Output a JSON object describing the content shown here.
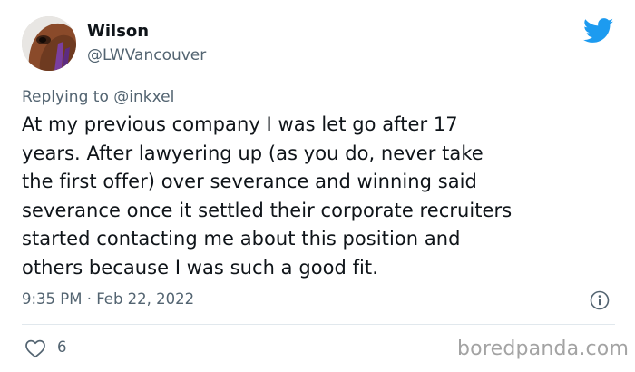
{
  "author": {
    "name": "Wilson",
    "handle": "@LWVancouver",
    "avatar_icon": "horse-avatar"
  },
  "reply_context": {
    "prefix": "Replying to",
    "mention": "@inkxel"
  },
  "tweet": {
    "lines": [
      "At my previous company I was let go after 17",
      "years. After lawyering up (as you do, never take",
      "the first offer) over severance and winning said",
      "severance once it settled their corporate recruiters",
      "started contacting me about this position and",
      "others because I was such a good fit."
    ],
    "timestamp": "9:35 PM · Feb 22, 2022"
  },
  "engagement": {
    "likes": "6"
  },
  "watermark": "boredpanda.com",
  "colors": {
    "twitter_blue": "#1d9bf0",
    "secondary_text": "#536471",
    "primary_text": "#0f1419"
  }
}
